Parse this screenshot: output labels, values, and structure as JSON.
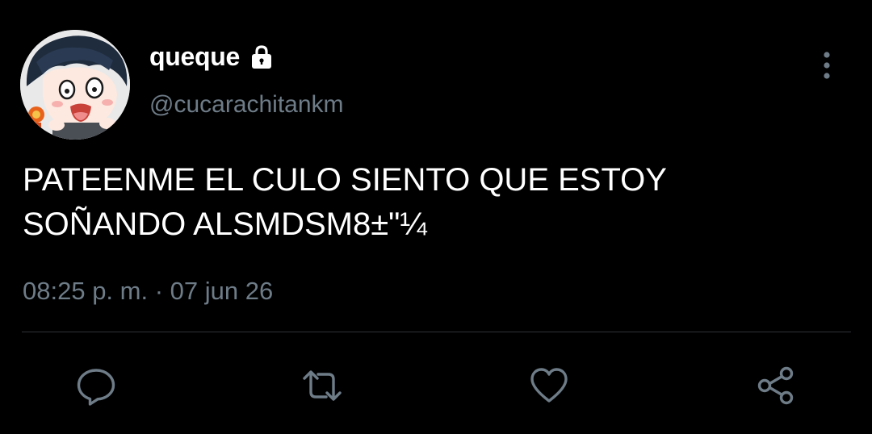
{
  "user": {
    "display_name": "queque",
    "handle": "@cucarachitankm",
    "protected": true,
    "avatar_icon": "anime-avatar"
  },
  "tweet": {
    "text_line1": "PATEENME EL CULO SIENTO QUE ESTOY",
    "text_line2": "SOÑANDO ALSMDSM8±\"¼",
    "meta": "08:25 p. m. · 07 jun 26"
  },
  "actions": {
    "reply_icon": "reply-icon",
    "retweet_icon": "retweet-icon",
    "like_icon": "heart-icon",
    "share_icon": "share-icon",
    "more_icon": "more-vertical-icon"
  },
  "colors": {
    "background": "#000000",
    "text": "#ffffff",
    "secondary": "#6e7c88",
    "divider": "#2f3336"
  }
}
